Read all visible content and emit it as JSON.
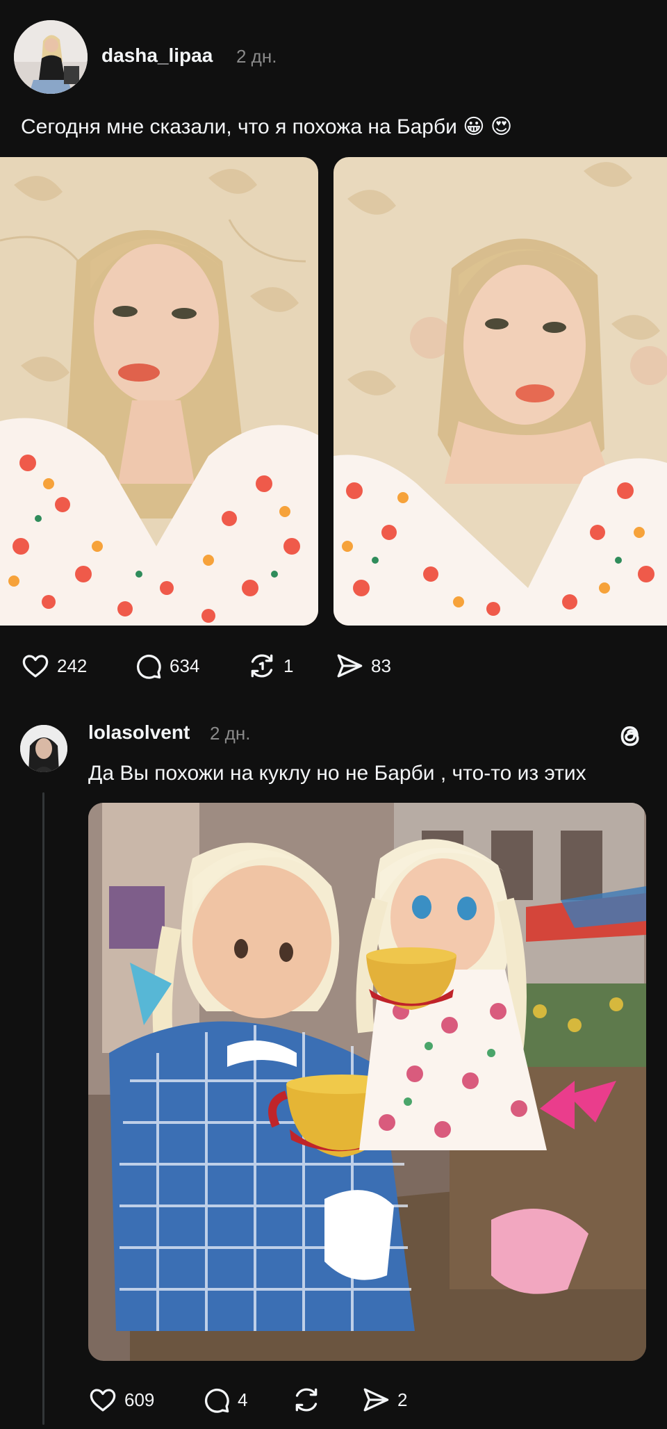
{
  "posts": [
    {
      "username": "dasha_lipaa",
      "time": "2 дн.",
      "text": "Сегодня мне сказали, что я похожа на Барби 😀 😍",
      "images": [
        "selfie-photo-1",
        "selfie-photo-2"
      ],
      "actions": {
        "likes": "242",
        "comments": "634",
        "reposts": "1",
        "shares": "83"
      }
    },
    {
      "username": "lolasolvent",
      "time": "2 дн.",
      "text": "Да Вы похожи на куклу но не Барби , что-то из этих",
      "images": [
        "dolls-photo"
      ],
      "actions": {
        "likes": "609",
        "comments": "4",
        "reposts": "",
        "shares": "2"
      }
    }
  ],
  "icons": {
    "like": "heart-icon",
    "comment": "comment-bubble-icon",
    "repost": "repost-icon",
    "share": "share-icon",
    "logo": "threads-logo-icon"
  },
  "colors": {
    "background": "#101010",
    "text": "#f3f5f7",
    "muted": "#8a8a8a",
    "thread_line": "#333638"
  }
}
